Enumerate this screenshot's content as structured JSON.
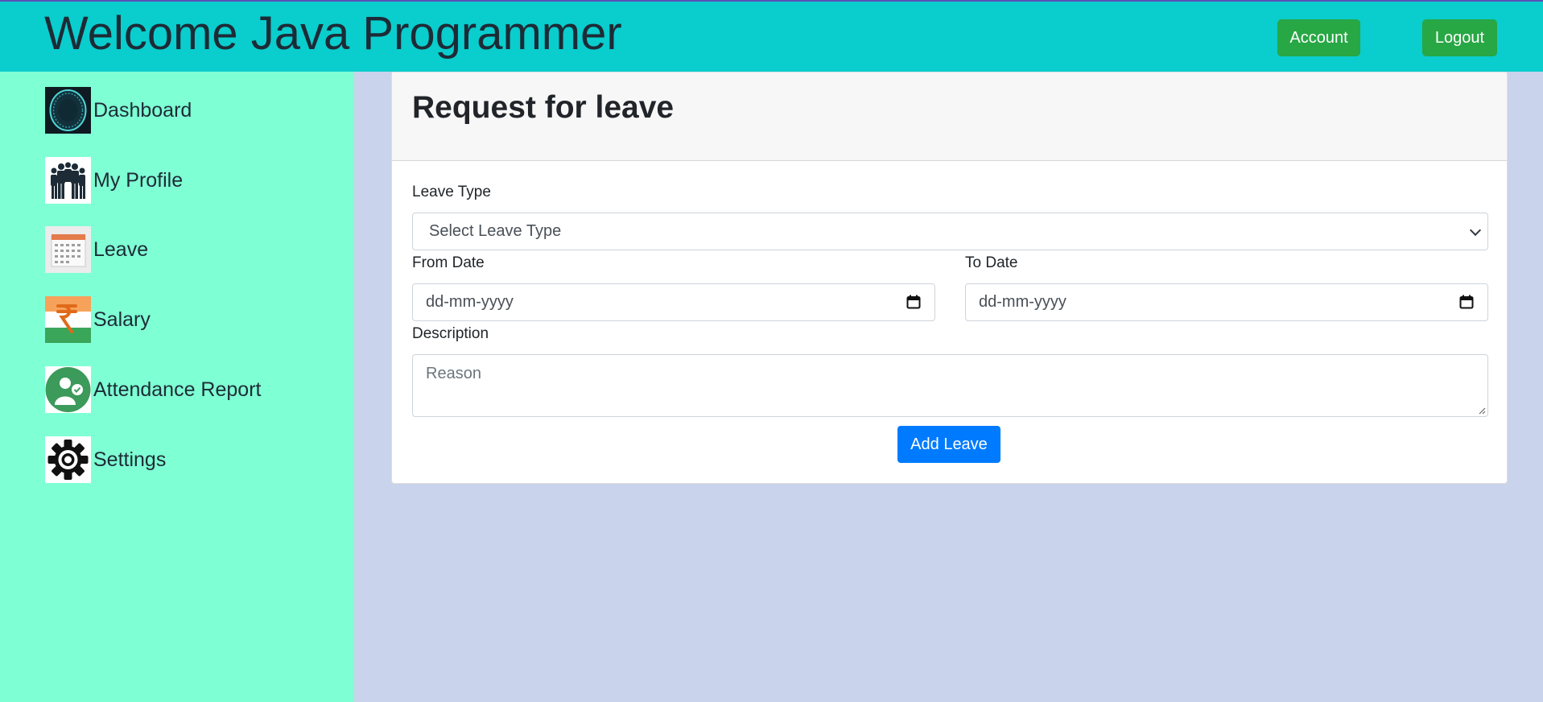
{
  "header": {
    "title": "Welcome Java Programmer",
    "account_label": "Account",
    "logout_label": "Logout"
  },
  "sidebar": {
    "items": [
      {
        "label": "Dashboard",
        "icon": "dashboard-icon"
      },
      {
        "label": "My Profile",
        "icon": "people-icon"
      },
      {
        "label": "Leave",
        "icon": "calendar-icon"
      },
      {
        "label": "Salary",
        "icon": "rupee-icon"
      },
      {
        "label": "Attendance Report",
        "icon": "attendance-icon"
      },
      {
        "label": "Settings",
        "icon": "gear-icon"
      }
    ]
  },
  "form": {
    "title": "Request for leave",
    "leave_type_label": "Leave Type",
    "leave_type_value": "Select Leave Type",
    "from_date_label": "From Date",
    "from_date_placeholder": "dd-mm-yyyy",
    "to_date_label": "To Date",
    "to_date_placeholder": "dd-mm-yyyy",
    "description_label": "Description",
    "description_placeholder": "Reason",
    "submit_label": "Add Leave"
  },
  "colors": {
    "header_bg": "#0acdcd",
    "sidebar_bg": "#7fffd4",
    "content_bg": "#cad3ec",
    "button_green": "#28a745",
    "button_blue": "#007bff"
  }
}
